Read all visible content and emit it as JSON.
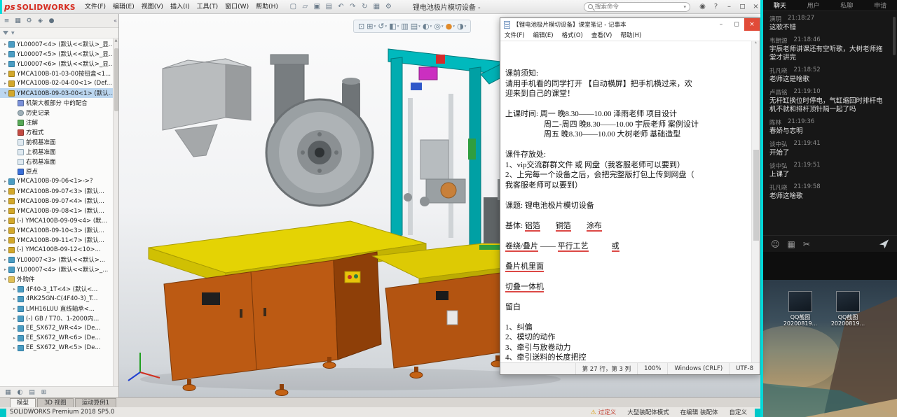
{
  "app": {
    "logo_mark": "ps",
    "logo_text": "SOLIDWORKS",
    "menus": [
      "文件(F)",
      "编辑(E)",
      "视图(V)",
      "插入(I)",
      "工具(T)",
      "窗口(W)",
      "帮助(H)"
    ],
    "toolbar_icons": [
      {
        "name": "new-document",
        "glyph": "▢"
      },
      {
        "name": "open-document",
        "glyph": "▱"
      },
      {
        "name": "save-document",
        "glyph": "▣"
      },
      {
        "name": "print-document",
        "glyph": "▤"
      },
      {
        "name": "undo",
        "glyph": "↶"
      },
      {
        "name": "redo",
        "glyph": "↷"
      },
      {
        "name": "rebuild",
        "glyph": "↻"
      },
      {
        "name": "file-properties",
        "glyph": "▦"
      },
      {
        "name": "options",
        "glyph": "⚙"
      }
    ],
    "title": "锂电池极片模切设备 -",
    "search_placeholder": "搜索命令",
    "controls": {
      "sign_in": "◉",
      "help": "?",
      "minimize": "–",
      "restore": "◻",
      "close": "×"
    }
  },
  "left_panel": {
    "tab_icons": [
      {
        "name": "featuremanager-tab",
        "glyph": "≡"
      },
      {
        "name": "propertymanager-tab",
        "glyph": "▦"
      },
      {
        "name": "configurationmanager-tab",
        "glyph": "⚙"
      },
      {
        "name": "dimxpertmanager-tab",
        "glyph": "◈"
      },
      {
        "name": "displaymanager-tab",
        "glyph": "●"
      }
    ],
    "collapse_glyph": "«",
    "footer_icons": [
      {
        "name": "hide-tree-pane",
        "glyph": "▦"
      },
      {
        "name": "display-pane",
        "glyph": "◐"
      },
      {
        "name": "appearance-pane",
        "glyph": "▤"
      },
      {
        "name": "split-pane",
        "glyph": "⊞"
      }
    ],
    "tree": [
      {
        "label": "YL00007<4> (默认<<默认>_显...",
        "type": "part",
        "level": 1,
        "arrow": true
      },
      {
        "label": "YL00007<5> (默认<<默认>_显...",
        "type": "part",
        "level": 1,
        "arrow": true
      },
      {
        "label": "YL00007<6> (默认<<默认>_显...",
        "type": "part",
        "level": 1,
        "arrow": true
      },
      {
        "label": "YMCA100B-01-03-00按钮盒<1...",
        "type": "asm",
        "level": 1,
        "arrow": true
      },
      {
        "label": "YMCA100B-02-04-00<1> (Def...",
        "type": "asm",
        "level": 1,
        "arrow": true
      },
      {
        "label": "YMCA100B-09-03-00<1> (默认...",
        "type": "asm",
        "level": 1,
        "arrow": true,
        "expanded": true,
        "selected": true
      },
      {
        "label": "机架大板部分 中的配合",
        "type": "matefolder",
        "level": 2
      },
      {
        "label": "历史记录",
        "type": "history",
        "level": 2
      },
      {
        "label": "注解",
        "type": "annot",
        "level": 2
      },
      {
        "label": "方程式",
        "type": "eq",
        "level": 2
      },
      {
        "label": "前视基准面",
        "type": "plane",
        "level": 2
      },
      {
        "label": "上视基准面",
        "type": "plane",
        "level": 2
      },
      {
        "label": "右视基准面",
        "type": "plane",
        "level": 2
      },
      {
        "label": "原点",
        "type": "origin",
        "level": 2
      },
      {
        "label": "YMCA100B-09-06<1>->?",
        "type": "part",
        "level": 1,
        "arrow": true
      },
      {
        "label": "YMCA100B-09-07<3> (默认...",
        "type": "asm",
        "level": 1,
        "arrow": true
      },
      {
        "label": "YMCA100B-09-07<4> (默认...",
        "type": "asm",
        "level": 1,
        "arrow": true
      },
      {
        "label": "YMCA100B-09-08<1> (默认...",
        "type": "asm",
        "level": 1,
        "arrow": true
      },
      {
        "label": "(-) YMCA100B-09-09<4> (默...",
        "type": "asm",
        "level": 1,
        "arrow": true
      },
      {
        "label": "YMCA100B-09-10<3> (默认...",
        "type": "asm",
        "level": 1,
        "arrow": true
      },
      {
        "label": "YMCA100B-09-11<7> (默认...",
        "type": "asm",
        "level": 1,
        "arrow": true
      },
      {
        "label": "(-) YMCA100B-09-12<10>...",
        "type": "asm",
        "level": 1,
        "arrow": true
      },
      {
        "label": "YL00007<3> (默认<<默认>...",
        "type": "part",
        "level": 1,
        "arrow": true
      },
      {
        "label": "YL00007<4> (默认<<默认>_...",
        "type": "part",
        "level": 1,
        "arrow": true
      },
      {
        "label": "外购件",
        "type": "folder",
        "level": 1,
        "arrow": true,
        "expanded": true
      },
      {
        "label": "4F40-3_1T<4> (默认<...",
        "type": "part",
        "level": 2,
        "arrow": true
      },
      {
        "label": "4RK25GN-C(4F40-3)_T...",
        "type": "part",
        "level": 2,
        "arrow": true
      },
      {
        "label": "LMH16LUU 直线轴承<...",
        "type": "part",
        "level": 2,
        "arrow": true
      },
      {
        "label": "(-) GB / T70、1-2000内...",
        "type": "part",
        "level": 2,
        "arrow": true
      },
      {
        "label": "EE_SX672_WR<4> (De...",
        "type": "part",
        "level": 2,
        "arrow": true
      },
      {
        "label": "EE_SX672_WR<6> (De...",
        "type": "part",
        "level": 2,
        "arrow": true
      },
      {
        "label": "EE_SX672_WR<5> (De...",
        "type": "part",
        "level": 2,
        "arrow": true
      }
    ],
    "doc_tabs": [
      {
        "label": "模型",
        "active": true
      },
      {
        "label": "3D 视图",
        "active": false
      },
      {
        "label": "运动算例1",
        "active": false
      }
    ]
  },
  "viewport_toolbar": [
    {
      "name": "zoom-fit",
      "glyph": "⊡"
    },
    {
      "name": "zoom-area",
      "glyph": "⊞",
      "caret": true
    },
    {
      "name": "previous-view",
      "glyph": "↺",
      "caret": true
    },
    {
      "name": "section-view",
      "glyph": "◧",
      "caret": true
    },
    {
      "name": "annotation-visibility",
      "glyph": "▥"
    },
    {
      "name": "view-orientation",
      "glyph": "▤",
      "caret": true
    },
    {
      "name": "display-style",
      "glyph": "◐",
      "caret": true
    },
    {
      "name": "hide-show-items",
      "glyph": "◎",
      "caret": true
    },
    {
      "name": "edit-appearance",
      "glyph": "●",
      "color": "#e08a2a",
      "caret": true
    },
    {
      "name": "view-settings",
      "glyph": "◑",
      "caret": true
    }
  ],
  "notepad": {
    "title": "【锂电池极片模切设备】课堂笔记 - 记事本",
    "menus": [
      "文件(F)",
      "编辑(E)",
      "格式(O)",
      "查看(V)",
      "帮助(H)"
    ],
    "controls": {
      "minimize": "–",
      "restore": "◻",
      "close": "×"
    },
    "lines": [
      "课前须知:",
      "请用手机看的同学打开 【自动横屏】把手机横过来，欢",
      "迎来到自己的课堂！",
      "",
      "上课时间: 周一 晚8.30——10.00 泽雨老师 项目设计",
      "　　　　　周二-周四 晚8.30——10.00 宇辰老师 案例设计",
      "　　　　　周五 晚8.30——10.00 大树老师 基础造型",
      "",
      "课件存放处:",
      "1、vip交流群群文件 或 网盘（我客服老师可以要到）",
      "2、上完每一个设备之后，会把完整版打包上传到网盘（",
      "我客服老师可以要到）",
      "",
      "课题: 锂电池极片模切设备",
      "",
      "基体: 铝箔　　铜箔　　涂布",
      "",
      "卷绕/叠片 —— 平行工艺　　　或",
      "",
      "叠片机里面",
      "",
      "切叠一体机",
      "",
      "留白",
      "",
      "1、纠偏",
      "2、模切的动作",
      "3、牵引与放卷动力",
      "4、牵引送料的长度把控"
    ],
    "annotations": [
      {
        "line": 15,
        "terms": [
          "铝箔",
          "铜箔",
          "涂布"
        ]
      },
      {
        "line": 17,
        "terms": [
          "卷绕/叠片",
          "平行工艺",
          "或"
        ]
      },
      {
        "line": 19,
        "terms": [
          "叠片机里面"
        ]
      },
      {
        "line": 21,
        "terms": [
          "切叠一体机"
        ]
      }
    ],
    "status": {
      "line_col": "第 27 行，第 3 列",
      "zoom": "100%",
      "eol": "Windows (CRLF)",
      "encoding": "UTF-8"
    }
  },
  "chat": {
    "tabs": [
      {
        "label": "聊天",
        "active": true
      },
      {
        "label": "用户",
        "active": false
      },
      {
        "label": "私聊",
        "active": false
      },
      {
        "label": "申请",
        "active": false
      }
    ],
    "messages": [
      {
        "name": "演玥",
        "time": "21:18:27",
        "text": "这歌不错"
      },
      {
        "name": "韦朝源",
        "time": "21:18:46",
        "text": "宇辰老师讲课还有空听歌，大树老师拖堂才讲完"
      },
      {
        "name": "孔凡晓",
        "time": "21:18:52",
        "text": "老师这是啥歌"
      },
      {
        "name": "卢昌铭",
        "time": "21:19:10",
        "text": "无杆缸换位时停电，气缸缩回时排杆电机不就和排杆顶针隔一起了吗"
      },
      {
        "name": "陈林",
        "time": "21:19:36",
        "text": "春娇与志明"
      },
      {
        "name": "谈中弘",
        "time": "21:19:41",
        "text": "开始了"
      },
      {
        "name": "谈中弘",
        "time": "21:19:51",
        "text": "上课了"
      },
      {
        "name": "孔凡晓",
        "time": "21:19:58",
        "text": "老师这啥歌"
      }
    ],
    "toolbar_icons": [
      {
        "name": "emoji",
        "glyph": "☺"
      },
      {
        "name": "image",
        "glyph": "▦"
      },
      {
        "name": "screenshot",
        "glyph": "✂"
      }
    ]
  },
  "desktop": {
    "icons": [
      {
        "line1": "QQ截图",
        "line2": "20200819..."
      },
      {
        "line1": "QQ截图",
        "line2": "20200819..."
      }
    ]
  },
  "statusbar": {
    "product": "SOLIDWORKS Premium 2018 SP5.0",
    "warning": "过定义",
    "mode": "大型装配体模式",
    "editing": "在编辑 装配体",
    "customize": "自定义"
  },
  "colors": {
    "accent_cyan": "#00d8d8",
    "sw_red": "#d62b1f",
    "machine_yellow": "#e4d304",
    "machine_orange": "#bc5a13",
    "machine_cyan": "#00b4b8"
  }
}
